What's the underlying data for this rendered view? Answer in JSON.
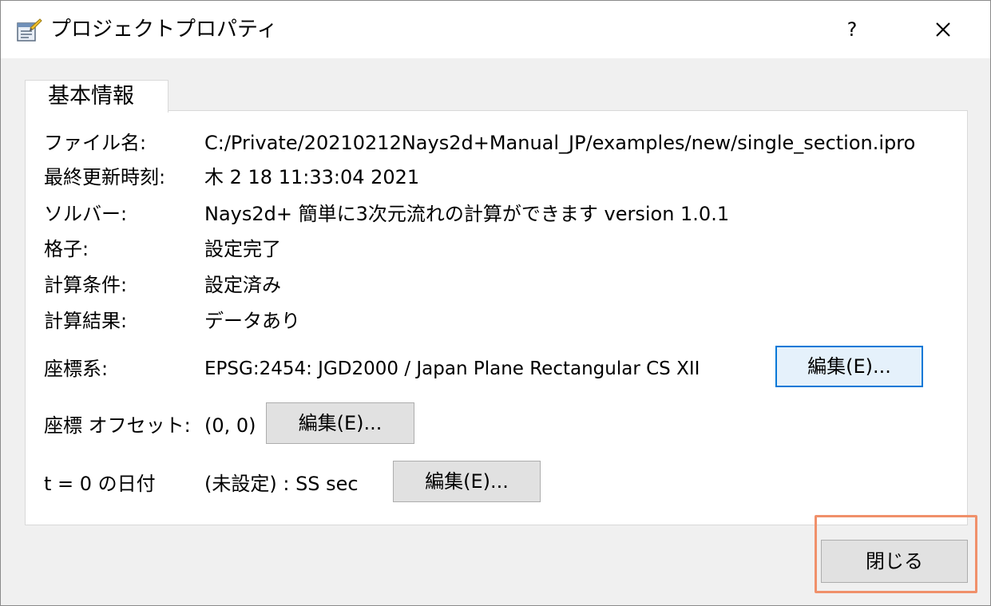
{
  "window": {
    "title": "プロジェクトプロパティ",
    "help_label": "?"
  },
  "tab": {
    "label": "基本情報"
  },
  "properties": {
    "file": {
      "label": "ファイル名:",
      "value": "C:/Private/20210212Nays2d+Manual_JP/examples/new/single_section.ipro"
    },
    "modified": {
      "label": "最終更新時刻:",
      "value": "木 2 18 11:33:04 2021"
    },
    "solver": {
      "label": "ソルバー:",
      "value": "Nays2d+ 簡単に3次元流れの計算ができます version 1.0.1"
    },
    "grid": {
      "label": "格子:",
      "value": "設定完了"
    },
    "conditions": {
      "label": "計算条件:",
      "value": "設定済み"
    },
    "results": {
      "label": "計算結果:",
      "value": "データあり"
    },
    "coord_system": {
      "label": "座標系:",
      "value": "EPSG:2454: JGD2000 / Japan Plane Rectangular CS XII",
      "button": "編集(E)..."
    },
    "coord_offset": {
      "label": "座標 オフセット:",
      "value": "(0, 0)",
      "button": "編集(E)..."
    },
    "zero_date": {
      "label": "t = 0 の日付",
      "value": "(未設定) : SS sec",
      "button": "編集(E)..."
    }
  },
  "footer": {
    "close_label": "閉じる"
  },
  "colors": {
    "focus_border": "#0078d7",
    "highlight_border": "#f0906a"
  }
}
